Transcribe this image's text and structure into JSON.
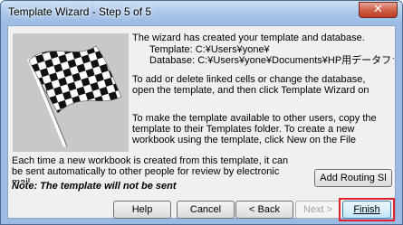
{
  "window": {
    "title": "Template Wizard - Step 5 of 5",
    "close_glyph": "✕"
  },
  "body": {
    "line1": "The wizard has created your template and database.",
    "template_line": "Template: C:¥Users¥yone¥",
    "database_line": "Database: C:¥Users¥yone¥Documents¥HP用データファ",
    "para2_l1": "To add or delete linked cells or change the database,",
    "para2_l2": "open the template, and then click Template Wizard on",
    "para3_l1": "To make the template available to other users, copy the",
    "para3_l2": "template to their Templates folder. To create a new",
    "para3_l3": "workbook using the template, click New on the File",
    "para4_l1": "Each time a new workbook is created from this template, it can",
    "para4_l2": "be sent automatically to other people for review by electronic",
    "para4_l3": "mail.",
    "note": "Note: The template will not be sent"
  },
  "buttons": {
    "add_routing": "Add Routing Sl",
    "help": "Help",
    "cancel": "Cancel",
    "back": "< Back",
    "next": "Next >",
    "finish": "Finish"
  },
  "colors": {
    "finish_highlight": "#e0202a",
    "title_gradient": "#aac7ea"
  }
}
